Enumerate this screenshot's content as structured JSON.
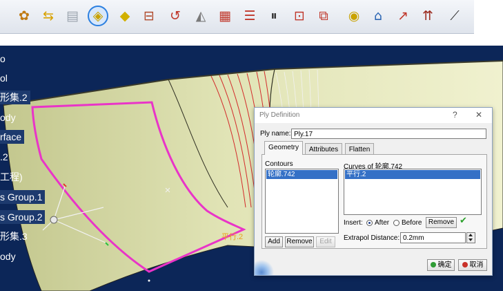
{
  "toolbar": {
    "icons": [
      {
        "name": "ply-group-icon",
        "glyph": "✿",
        "color": "#c07a12"
      },
      {
        "name": "ply-exchange-icon",
        "glyph": "⇆",
        "color": "#d8a100"
      },
      {
        "name": "stacking-icon",
        "glyph": "▤",
        "color": "#9aa3ad"
      },
      {
        "name": "ply-definition-icon",
        "glyph": "◈",
        "color": "#c9a200",
        "active": true
      },
      {
        "name": "shape-icon",
        "glyph": "◆",
        "color": "#d1b000"
      },
      {
        "name": "core-icon",
        "glyph": "⊟",
        "color": "#b04a2c"
      },
      {
        "name": "ply-from-curve-icon",
        "glyph": "↺",
        "color": "#c0372b"
      },
      {
        "name": "material-excess-icon",
        "glyph": "◭",
        "color": "#7a7a7a"
      },
      {
        "name": "ply-table-icon",
        "glyph": "▦",
        "color": "#c0372b"
      },
      {
        "name": "plies-list-icon",
        "glyph": "☰",
        "color": "#c0372b"
      },
      {
        "name": "symmetry-icon",
        "glyph": "⏸",
        "color": "#2d2d2d"
      },
      {
        "name": "split-icon",
        "glyph": "⊡",
        "color": "#c0372b"
      },
      {
        "name": "ply-transfer-icon",
        "glyph": "⧉",
        "color": "#c0372b"
      },
      {
        "name": "drape-direction-icon",
        "glyph": "◉",
        "color": "#c9a200"
      },
      {
        "name": "seed-point-icon",
        "glyph": "⌂",
        "color": "#2d67b4"
      },
      {
        "name": "flatten-icon",
        "glyph": "↗",
        "color": "#c0372b"
      },
      {
        "name": "rosette-icon",
        "glyph": "⇈",
        "color": "#9a2a1e"
      },
      {
        "name": "producibility-icon",
        "glyph": "⟋",
        "color": "#2d2d2d"
      }
    ]
  },
  "tree": {
    "items": [
      {
        "label": "o",
        "selected": false
      },
      {
        "label": "ol",
        "selected": false
      },
      {
        "label": "形集.2",
        "selected": true
      },
      {
        "label": "ody",
        "selected": false
      },
      {
        "label": "rface",
        "selected": true
      },
      {
        "label": ".2",
        "selected": false
      },
      {
        "label": "工程)",
        "selected": false
      },
      {
        "label": "s Group.1",
        "selected": true
      },
      {
        "label": "s Group.2",
        "selected": true
      },
      {
        "label": "形集.3",
        "selected": false
      },
      {
        "label": "ody",
        "selected": false
      }
    ]
  },
  "viewport": {
    "parallel_label": "平行.2",
    "colors": {
      "background": "#0c2658",
      "surface": "#e3e6b8",
      "contour": "#e934c8",
      "curves": "#d32a2a",
      "sweep": "#f2f2f2"
    }
  },
  "dialog": {
    "title": "Ply Definition",
    "help_glyph": "?",
    "close_glyph": "✕",
    "ply_name_label": "Ply name:",
    "ply_name_value": "Ply.17",
    "tabs": [
      "Geometry",
      "Attributes",
      "Flatten"
    ],
    "active_tab": "Geometry",
    "contours_label": "Contours",
    "contours_items": [
      "轮廓.742"
    ],
    "curves_label": "Curves of 轮廓.742",
    "curves_items": [
      "平行.2"
    ],
    "add_label": "Add",
    "remove_label": "Remove",
    "edit_label": "Edit",
    "insert_label": "Insert:",
    "after_label": "After",
    "before_label": "Before",
    "insert_choice": "After",
    "curves_remove_label": "Remove",
    "check_glyph": "✔",
    "extrapol_label": "Extrapol Distance:",
    "extrapol_value": "0.2mm",
    "ok_label": "确定",
    "cancel_label": "取消"
  }
}
